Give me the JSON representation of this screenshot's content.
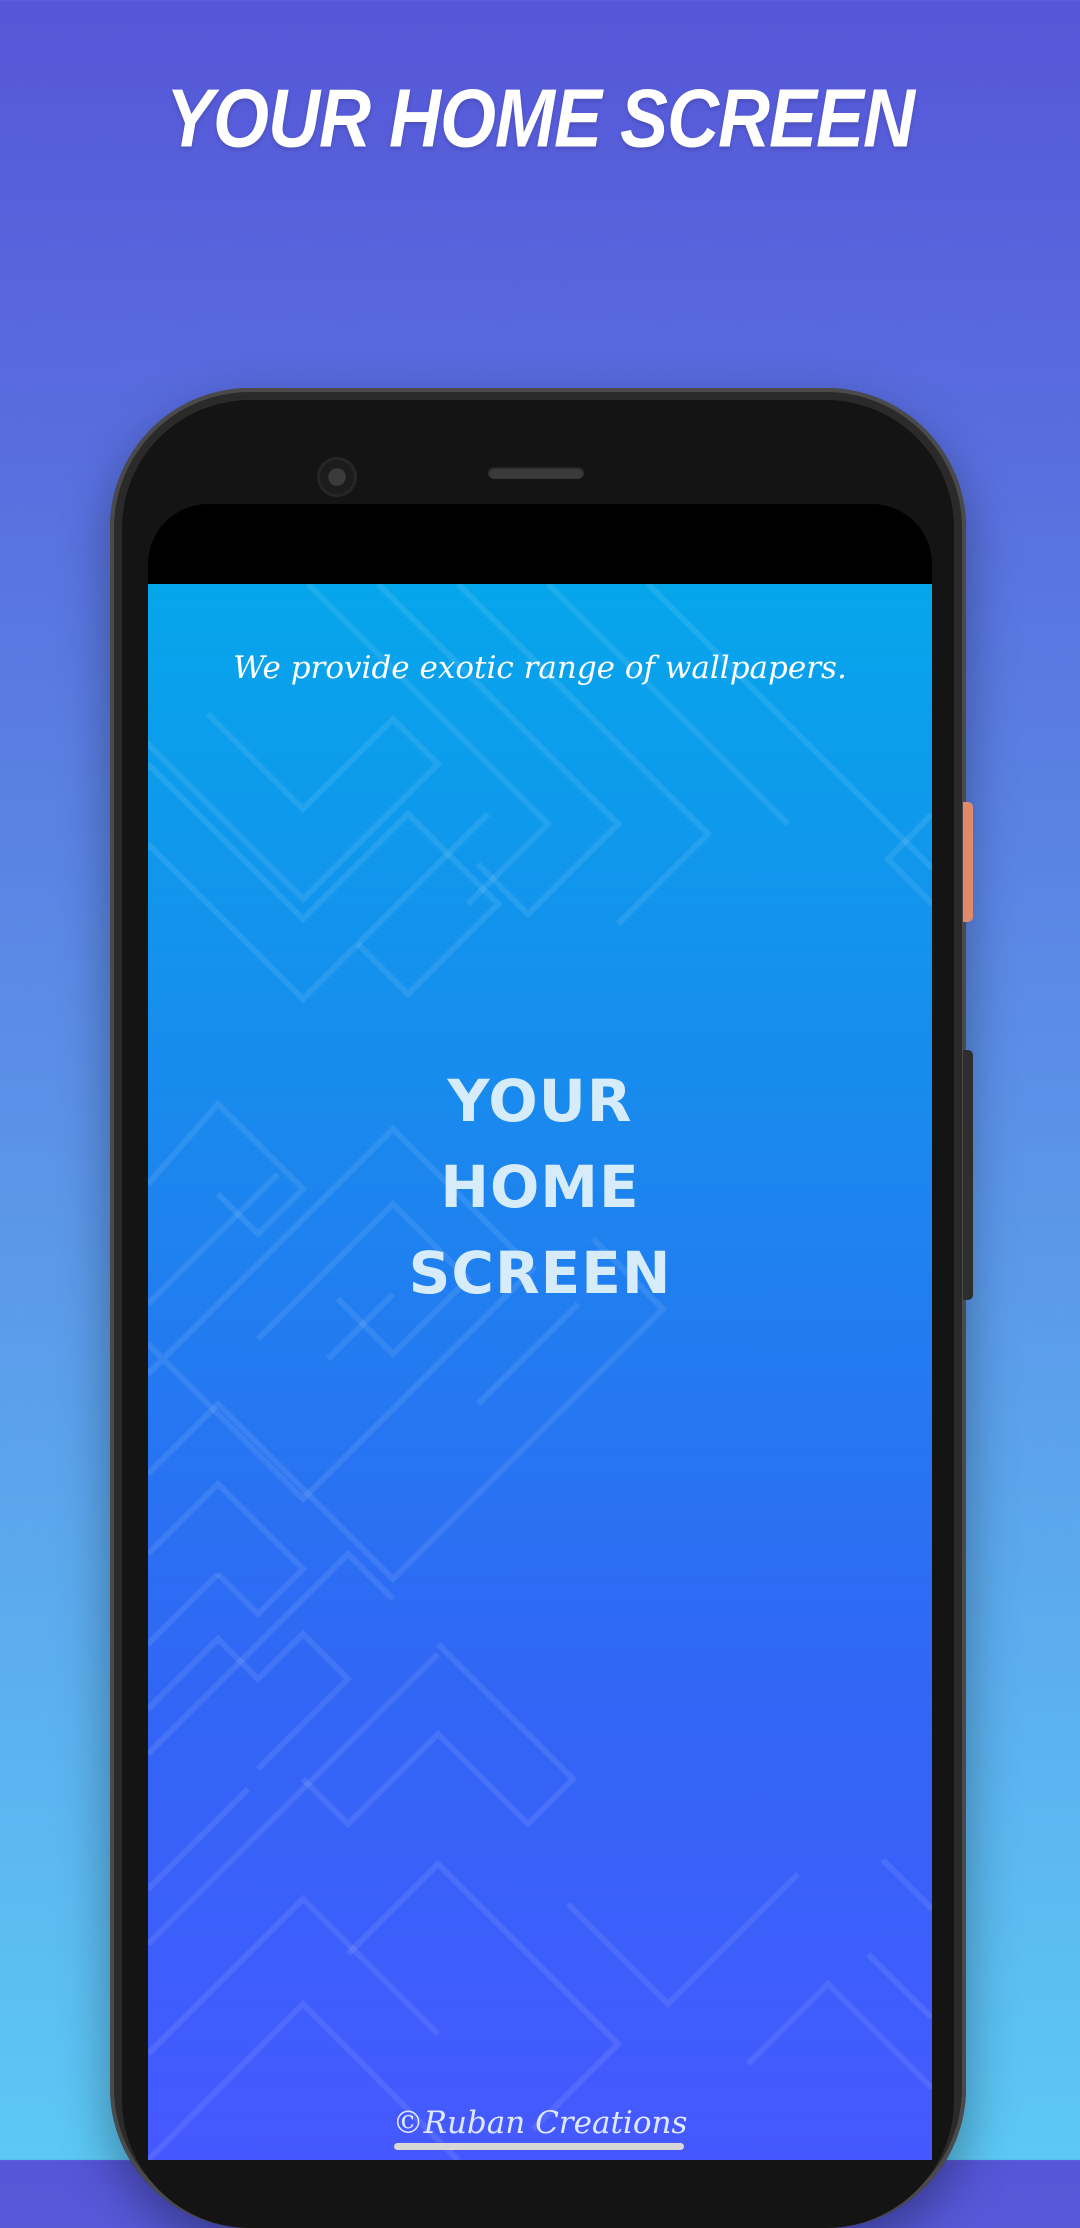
{
  "banner": {
    "title": "YOUR HOME SCREEN"
  },
  "screen": {
    "tagline": "We provide exotic range of wallpapers.",
    "title_lines": [
      "YOUR",
      "HOME",
      "SCREEN"
    ],
    "copyright": "©Ruban Creations"
  },
  "colors": {
    "background_top": "#5656d8",
    "background_bottom": "#5cc8f5",
    "wallpaper_top": "#06a6eb",
    "wallpaper_bottom": "#4558ff",
    "power_button": "#e08a6a"
  },
  "icons": [
    "front-camera-icon",
    "earpiece-speaker-icon"
  ]
}
